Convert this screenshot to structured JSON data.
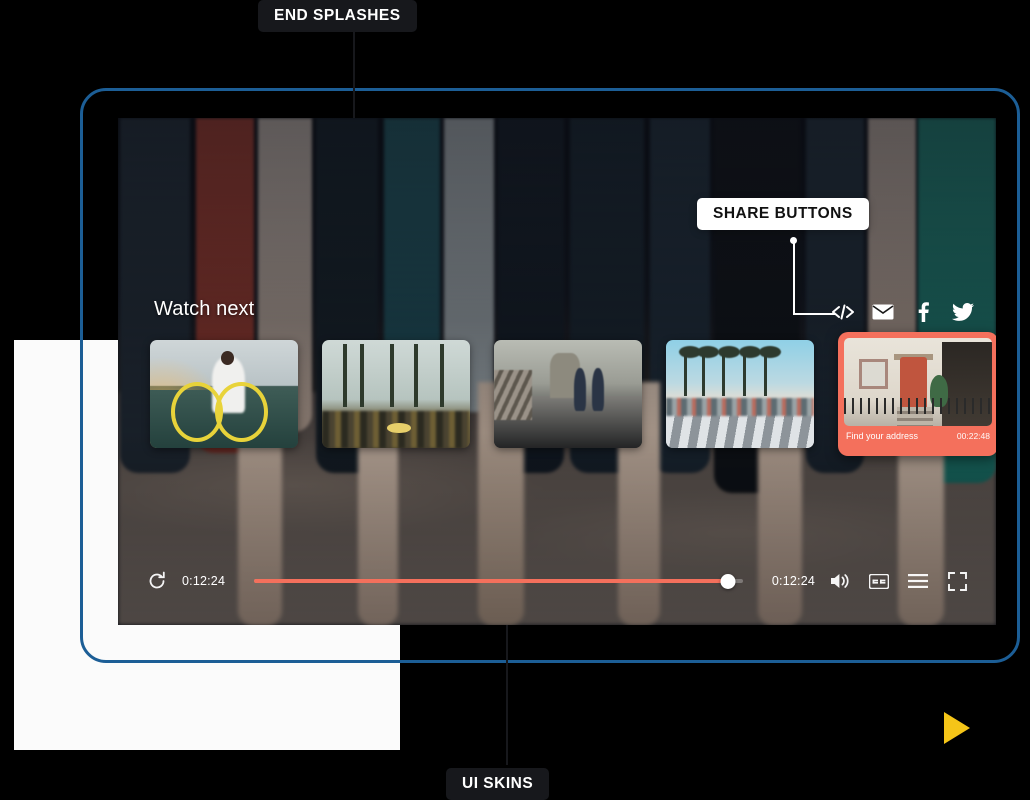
{
  "annotations": [
    {
      "id": "end-splashes",
      "label": "END SPLASHES",
      "style": "dark"
    },
    {
      "id": "share-buttons",
      "label": "SHARE BUTTONS",
      "style": "light"
    },
    {
      "id": "ui-skins",
      "label": "UI SKINS",
      "style": "dark"
    }
  ],
  "player": {
    "watch_next_label": "Watch next",
    "share": {
      "items": [
        {
          "icon": "embed-code-icon",
          "label": "Embed"
        },
        {
          "icon": "email-icon",
          "label": "Email"
        },
        {
          "icon": "facebook-icon",
          "label": "Facebook"
        },
        {
          "icon": "twitter-icon",
          "label": "Twitter"
        }
      ]
    },
    "controls": {
      "replay_icon": "replay-icon",
      "current_time": "0:12:24",
      "duration": "0:12:24",
      "progress_percent": 97,
      "volume_icon": "volume-icon",
      "captions_icon": "closed-captions-icon",
      "playlist_icon": "playlist-menu-icon",
      "fullscreen_icon": "fullscreen-icon"
    },
    "thumbnails": [
      {
        "title": "",
        "duration": "",
        "active": false,
        "art": "cyclist-sunset"
      },
      {
        "title": "",
        "duration": "",
        "active": false,
        "art": "palm-trees-crowd"
      },
      {
        "title": "",
        "duration": "",
        "active": false,
        "art": "bridge-runners"
      },
      {
        "title": "",
        "duration": "",
        "active": false,
        "art": "palm-crosswalk"
      },
      {
        "title": "Find your address",
        "duration": "00:22:48",
        "active": true,
        "art": "house-front-door"
      }
    ]
  },
  "decor": {
    "play_button_icon": "play-triangle-icon",
    "frame_color": "#1c5e96",
    "accent_color": "#f4705c",
    "play_color": "#f5c518"
  }
}
